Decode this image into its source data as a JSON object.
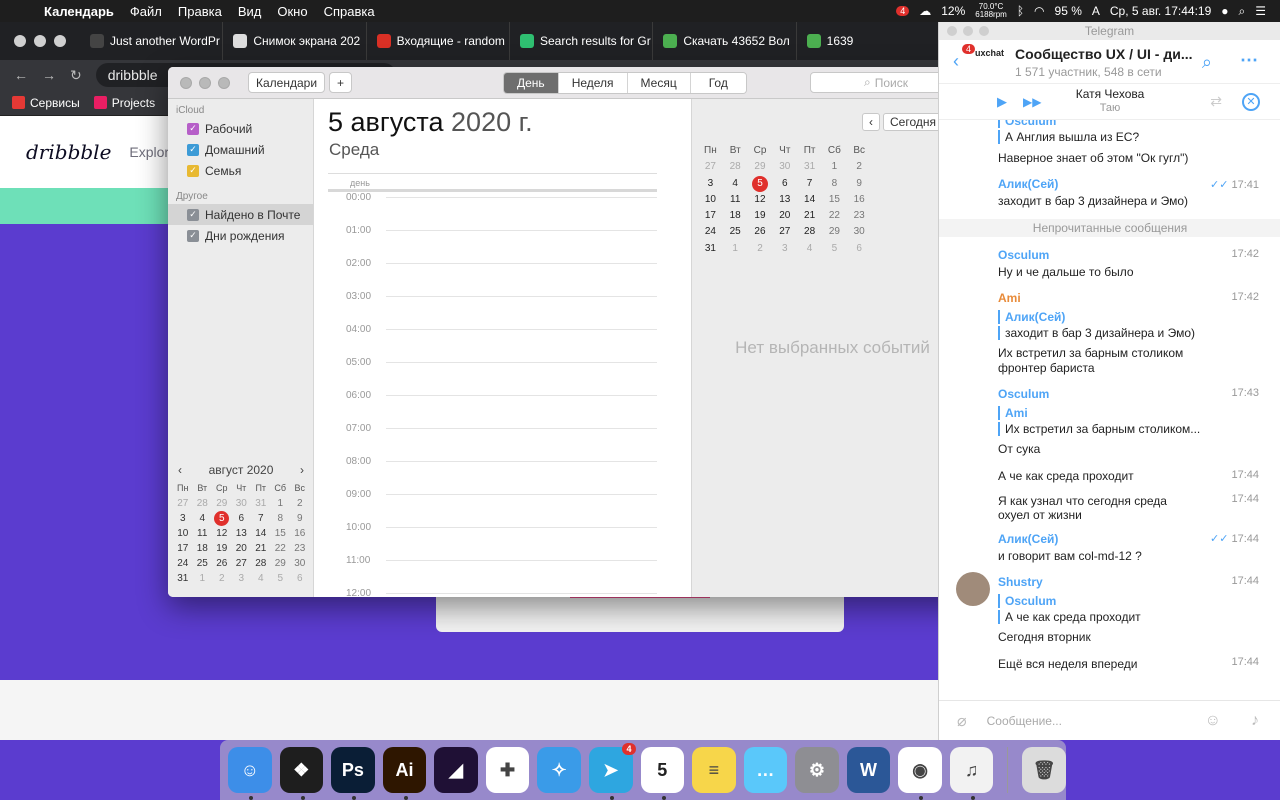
{
  "menubar": {
    "items": [
      "Календарь",
      "Файл",
      "Правка",
      "Вид",
      "Окно",
      "Справка"
    ],
    "badge": "4",
    "temp_top": "70.0°C",
    "temp_bottom": "6188rpm",
    "cpu": "12%",
    "battery": "95 %",
    "input": "A",
    "clock": "Ср, 5 авг.  17:44:19"
  },
  "browser": {
    "tabs": [
      {
        "title": "Just another WordPr",
        "color": "#444"
      },
      {
        "title": "Снимок экрана 202",
        "color": "#ddd"
      },
      {
        "title": "Входящие - random",
        "color": "#d93025"
      },
      {
        "title": "Search results for Gr",
        "color": "#2fbf71"
      },
      {
        "title": "Скачать 43652 Вол",
        "color": "#4caf50"
      },
      {
        "title": "1639",
        "color": "#4caf50"
      }
    ],
    "url": "dribbble",
    "bookmarks": [
      "Сервисы",
      "Projects"
    ],
    "site_logo": "dribbble",
    "site_nav": "Explore"
  },
  "calendar": {
    "toolbar": {
      "calendars_button": "Календари",
      "add_button": "+",
      "views": [
        "День",
        "Неделя",
        "Месяц",
        "Год"
      ],
      "active_view": "День",
      "search_placeholder": "Поиск"
    },
    "sidebar": {
      "group_icloud": "iCloud",
      "icloud_items": [
        {
          "label": "Рабочий",
          "color": "#b65fc8"
        },
        {
          "label": "Домашний",
          "color": "#3d9bd6"
        },
        {
          "label": "Семья",
          "color": "#e8b932"
        }
      ],
      "group_other": "Другое",
      "other_items": [
        {
          "label": "Найдено в Почте",
          "color": "#8a8f96"
        },
        {
          "label": "Дни рождения",
          "color": "#8a8f96"
        }
      ]
    },
    "mini_calendar": {
      "month": "август 2020",
      "weekdays": [
        "Пн",
        "Вт",
        "Ср",
        "Чт",
        "Пт",
        "Сб",
        "Вс"
      ],
      "weeks": [
        [
          "27",
          "28",
          "29",
          "30",
          "31",
          "1",
          "2"
        ],
        [
          "3",
          "4",
          "5",
          "6",
          "7",
          "8",
          "9"
        ],
        [
          "10",
          "11",
          "12",
          "13",
          "14",
          "15",
          "16"
        ],
        [
          "17",
          "18",
          "19",
          "20",
          "21",
          "22",
          "23"
        ],
        [
          "24",
          "25",
          "26",
          "27",
          "28",
          "29",
          "30"
        ],
        [
          "31",
          "1",
          "2",
          "3",
          "4",
          "5",
          "6"
        ]
      ],
      "today": "5"
    },
    "day_view": {
      "date": "5 августа",
      "year": "2020 г.",
      "weekday": "Среда",
      "allday_label": "день",
      "hours": [
        "00:00",
        "01:00",
        "02:00",
        "03:00",
        "04:00",
        "05:00",
        "06:00",
        "07:00",
        "08:00",
        "09:00",
        "10:00",
        "11:00",
        "12:00"
      ]
    },
    "right_panel": {
      "today_button": "Сегодня",
      "prev": "‹",
      "next": "›",
      "no_events": "Нет выбранных событий"
    }
  },
  "telegram": {
    "window_title": "Telegram",
    "badge": "4",
    "avatar_text": "uxchat",
    "chat_name": "Сообщество UX / UI - ди...",
    "chat_sub": "1 571 участник, 548 в сети",
    "player_artist": "Катя Чехова",
    "player_track": "Таю",
    "unread_label": "Непрочитанные сообщения",
    "messages": {
      "m0_sender": "Osculum",
      "m0_quote": "А Англия вышла из ЕС?",
      "m0_text": "Наверное знает об этом \"Ок гугл\")",
      "m1_sender": "Алик(Сей)",
      "m1_text": "заходит в бар 3 дизайнера и Эмо)",
      "m1_time": "17:41",
      "m2_sender": "Osculum",
      "m2_text": "Ну и че дальше то было",
      "m2_time": "17:42",
      "m3_sender": "Ami",
      "m3_time": "17:42",
      "m3_q_sender": "Алик(Сей)",
      "m3_q_text": "заходит в бар 3 дизайнера и Эмо)",
      "m3_text1": "Их встретил за барным столиком",
      "m3_text2": "фронтер бариста",
      "m4_sender": "Osculum",
      "m4_time": "17:43",
      "m4_q_sender": "Ami",
      "m4_q_text": "Их встретил за барным столиком...",
      "m4_text": "От сука",
      "m5_text": "А че как среда проходит",
      "m5_time": "17:44",
      "m6_text1": "Я как узнал что сегодня среда",
      "m6_text2": "охуел от жизни",
      "m6_time": "17:44",
      "m7_sender": "Алик(Сей)",
      "m7_text": "и говорит вам col-md-12 ?",
      "m7_time": "17:44",
      "m8_sender": "Shustry",
      "m8_time": "17:44",
      "m8_q_sender": "Osculum",
      "m8_q_text": "А че как среда проходит",
      "m8_text": "Сегодня вторник",
      "m9_text": "Ещё вся неделя впереди",
      "m9_time": "17:44"
    },
    "input_placeholder": "Сообщение..."
  },
  "dock": {
    "apps": [
      {
        "name": "finder-icon",
        "color": "#3d8ee8",
        "glyph": "☺"
      },
      {
        "name": "figma-icon",
        "color": "#1e1e1e",
        "glyph": "❖"
      },
      {
        "name": "photoshop-icon",
        "color": "#0a1e36",
        "glyph": "Ps"
      },
      {
        "name": "illustrator-icon",
        "color": "#2e1600",
        "glyph": "Ai"
      },
      {
        "name": "premiere-icon",
        "color": "#1f1035",
        "glyph": "◢"
      },
      {
        "name": "slack-icon",
        "color": "#ffffff",
        "glyph": "✚"
      },
      {
        "name": "safari-icon",
        "color": "#3a9be8",
        "glyph": "✧"
      },
      {
        "name": "telegram-icon",
        "color": "#2ea6e0",
        "glyph": "➤",
        "badge": "4"
      },
      {
        "name": "calendar-app-icon",
        "color": "#ffffff",
        "glyph": "5"
      },
      {
        "name": "notes-icon",
        "color": "#f7d64a",
        "glyph": "≡"
      },
      {
        "name": "messages-icon",
        "color": "#5ac8fa",
        "glyph": "…"
      },
      {
        "name": "system-preferences-icon",
        "color": "#8e8e93",
        "glyph": "⚙"
      },
      {
        "name": "word-icon",
        "color": "#2b5797",
        "glyph": "W"
      },
      {
        "name": "chrome-icon",
        "color": "#ffffff",
        "glyph": "◉"
      },
      {
        "name": "itunes-icon",
        "color": "#f2f2f2",
        "glyph": "♫"
      },
      {
        "name": "trash-icon",
        "color": "#dcdcdc",
        "glyph": "🗑"
      }
    ]
  }
}
